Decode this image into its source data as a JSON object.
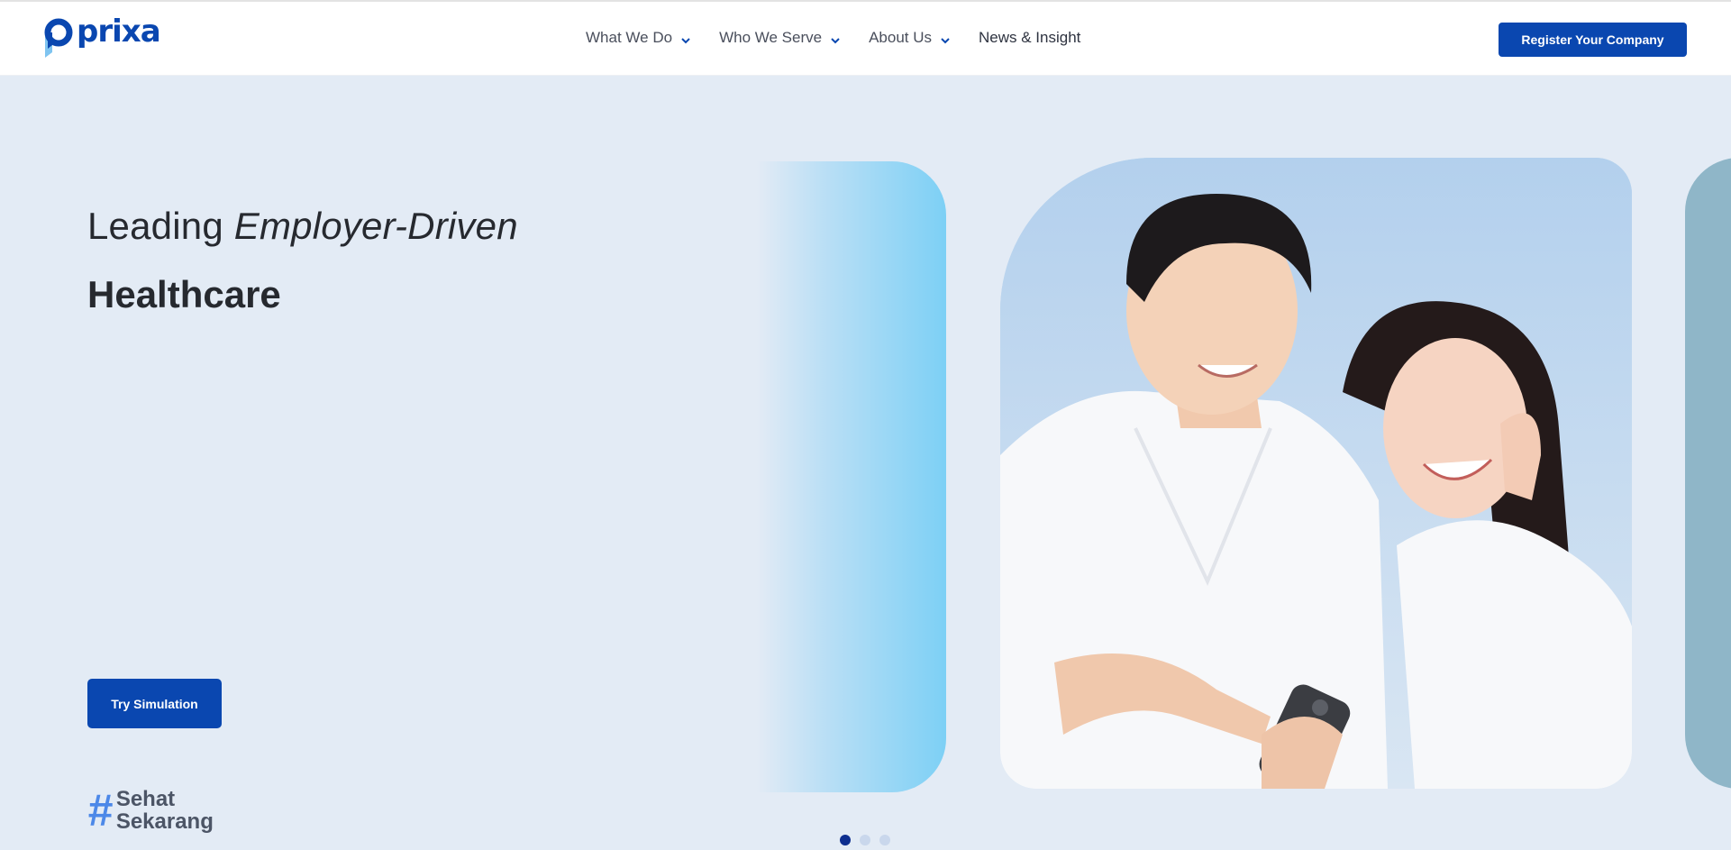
{
  "brand": {
    "name": "prixa",
    "color": "#0a47b0"
  },
  "nav": {
    "items": [
      {
        "label": "What We Do",
        "has_dropdown": true
      },
      {
        "label": "Who We Serve",
        "has_dropdown": true
      },
      {
        "label": "About Us",
        "has_dropdown": true
      },
      {
        "label": "News & Insight",
        "has_dropdown": false
      }
    ],
    "cta_label": "Register Your Company"
  },
  "hero": {
    "headline_prefix": "Leading ",
    "headline_emphasis": "Employer-Driven",
    "headline_line2": "Healthcare",
    "button_label": "Try Simulation",
    "tagline_hash": "#",
    "tagline_line1": "Sehat",
    "tagline_line2": "Sekarang",
    "background_color": "#e3ebf5"
  },
  "carousel": {
    "slide_count": 3,
    "active_index": 0,
    "main_image": "photo-young-couple-looking-at-phone"
  }
}
